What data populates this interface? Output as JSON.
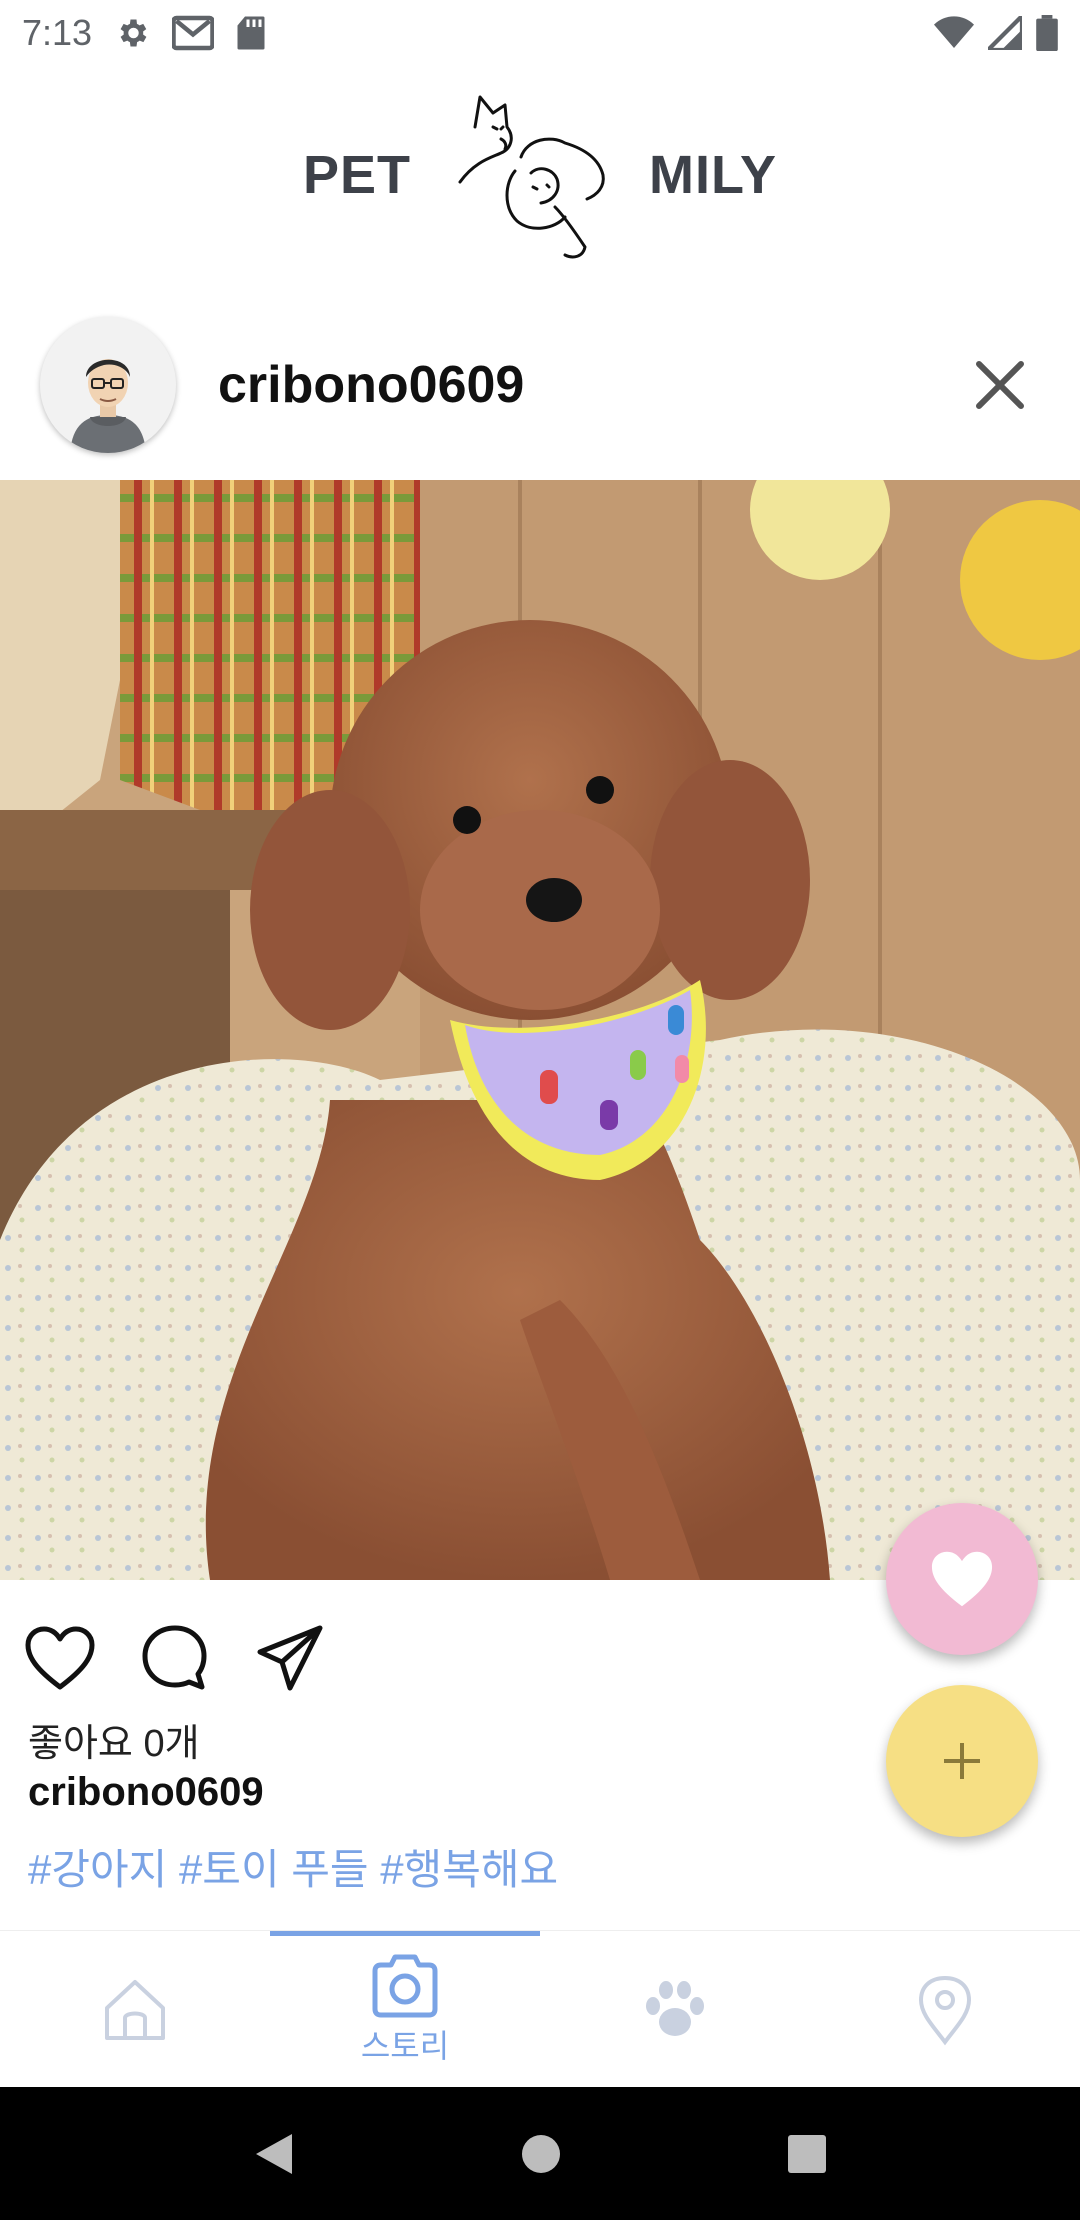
{
  "status_bar": {
    "time": "7:13",
    "icons": [
      "settings-icon",
      "gmail-icon",
      "sd-card-icon",
      "wifi-icon",
      "signal-icon",
      "battery-icon"
    ]
  },
  "logo": {
    "left": "PET",
    "right": "MILY"
  },
  "post": {
    "username": "cribono0609",
    "likes_text": "좋아요 0개",
    "caption_user": "cribono0609",
    "hashtags": "#강아지 #토이 푸들 #행복해요"
  },
  "bottom_nav": {
    "items": [
      {
        "icon": "home-icon",
        "label": ""
      },
      {
        "icon": "camera-icon",
        "label": "스토리",
        "active": true
      },
      {
        "icon": "paw-icon",
        "label": ""
      },
      {
        "icon": "location-pin-icon",
        "label": ""
      }
    ]
  },
  "colors": {
    "accent": "#7aa3e5",
    "fab_like": "#f2bad3",
    "fab_add": "#f6df84",
    "text_dark": "#3d4149"
  }
}
